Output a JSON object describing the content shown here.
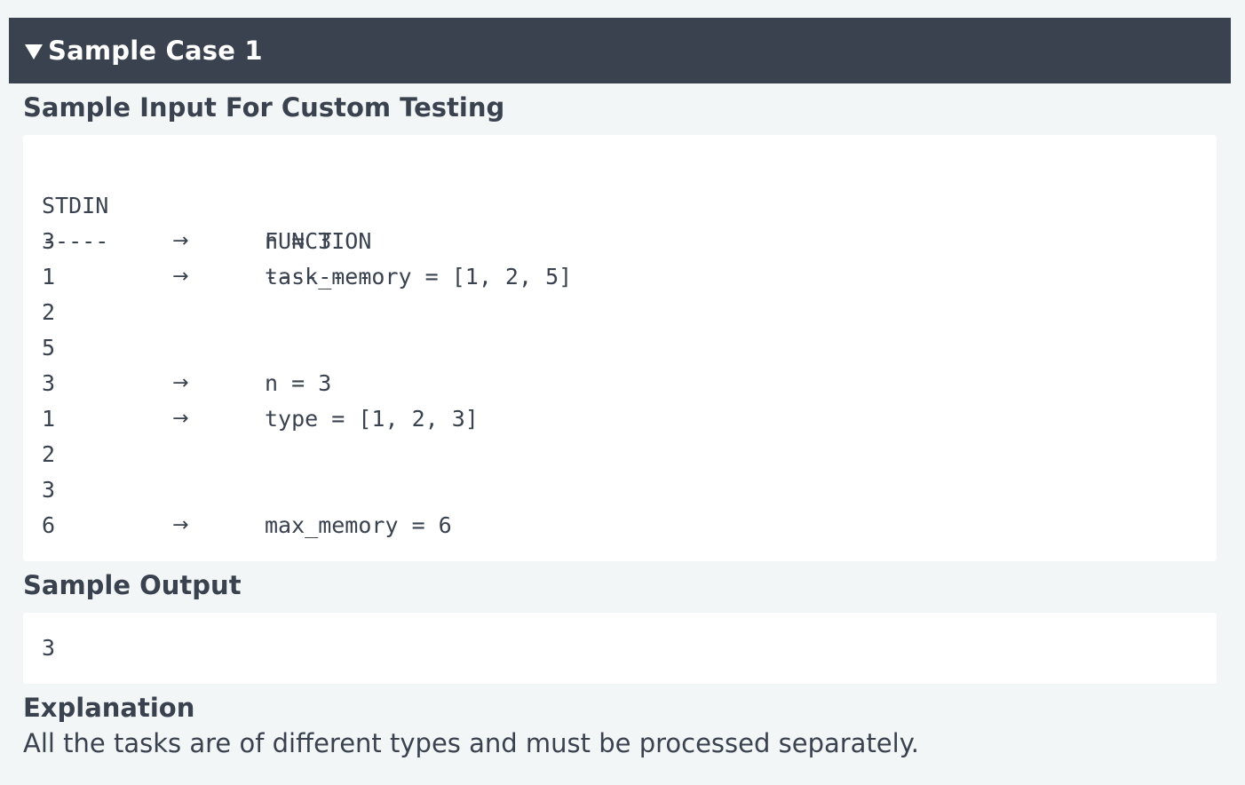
{
  "case": {
    "title": "Sample Case 1"
  },
  "headings": {
    "input": "Sample Input For Custom Testing",
    "output": "Sample Output",
    "explanation": "Explanation"
  },
  "input_table": {
    "header": {
      "stdin": "STDIN",
      "function": "FUNCTION"
    },
    "divider": {
      "stdin": "-----",
      "function": "--------"
    },
    "rows": [
      {
        "stdin": "3",
        "arrow": "→",
        "function": "n = 3"
      },
      {
        "stdin": "1",
        "arrow": "→",
        "function": "task_memory = [1, 2, 5]"
      },
      {
        "stdin": "2",
        "arrow": "",
        "function": ""
      },
      {
        "stdin": "5",
        "arrow": "",
        "function": ""
      },
      {
        "stdin": "3",
        "arrow": "→",
        "function": "n = 3"
      },
      {
        "stdin": "1",
        "arrow": "→",
        "function": "type = [1, 2, 3]"
      },
      {
        "stdin": "2",
        "arrow": "",
        "function": ""
      },
      {
        "stdin": "3",
        "arrow": "",
        "function": ""
      },
      {
        "stdin": "6",
        "arrow": "→",
        "function": "max_memory = 6"
      }
    ]
  },
  "output": {
    "value": "3"
  },
  "explanation": {
    "text": "All the tasks are of different types and must be processed separately."
  }
}
